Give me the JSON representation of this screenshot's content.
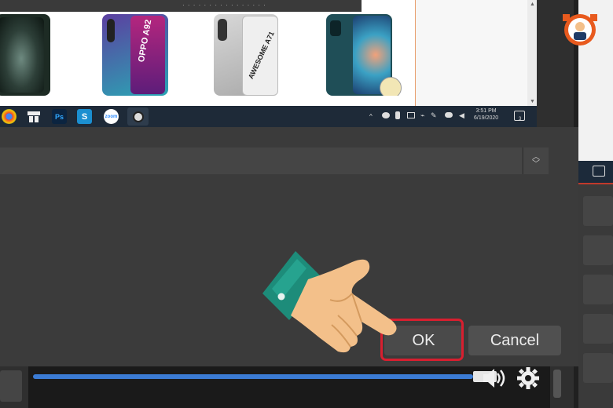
{
  "preview": {
    "phones": [
      {
        "name": "green-phone",
        "label": ""
      },
      {
        "name": "oppo-phone",
        "label": "OPPO A92"
      },
      {
        "name": "galaxy-a71-phone",
        "label": "AWESOME A71"
      },
      {
        "name": "redmi-phone",
        "label": ""
      }
    ]
  },
  "taskbar": {
    "apps": [
      "chrome-icon",
      "app-icon",
      "photoshop-icon",
      "snagit-icon",
      "zoom-icon",
      "obs-icon"
    ],
    "ps_label": "Ps",
    "snagit_label": "S",
    "zoom_label": "zoom",
    "time_text": "3:51 PM",
    "date_text": "6/19/2020",
    "notification_badge": "3"
  },
  "dialog": {
    "ok_label": "OK",
    "cancel_label": "Cancel"
  },
  "controls": {
    "progress": 0.95,
    "volume_icon": "volume-icon",
    "settings_icon": "gear-icon"
  },
  "colors": {
    "highlight": "#d81f2f",
    "progress": "#3b7bd4",
    "dialog_bg": "#3b3b3b"
  }
}
